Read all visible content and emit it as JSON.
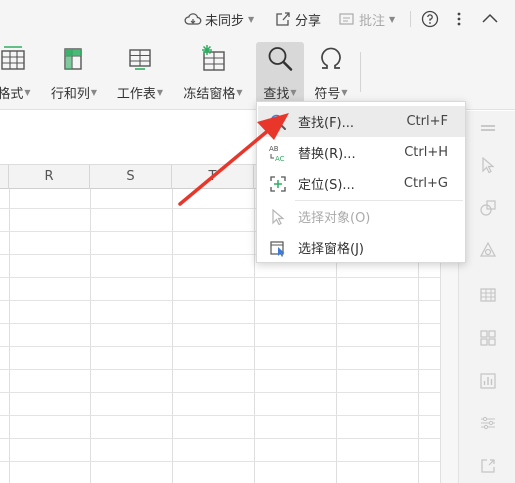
{
  "topbar": {
    "sync_label": "未同步",
    "share_label": "分享",
    "comment_label": "批注",
    "help_icon": "help-circle-icon",
    "more_icon": "more-vertical-icon",
    "collapse_icon": "chevron-up-icon"
  },
  "ribbon": {
    "format_label": "格式",
    "rowcol_label": "行和列",
    "sheet_label": "工作表",
    "freeze_label": "冻结窗格",
    "find_label": "查找",
    "symbol_label": "符号"
  },
  "columns": [
    "R",
    "S",
    "T"
  ],
  "menu": {
    "items": [
      {
        "label": "查找(F)...",
        "shortcut": "Ctrl+F",
        "icon": "search-icon"
      },
      {
        "label": "替换(R)...",
        "shortcut": "Ctrl+H",
        "icon": "replace-icon"
      },
      {
        "label": "定位(S)...",
        "shortcut": "Ctrl+G",
        "icon": "locate-icon"
      },
      {
        "label": "选择对象(O)",
        "shortcut": "",
        "icon": "select-object-icon"
      },
      {
        "label": "选择窗格(J)",
        "shortcut": "",
        "icon": "selection-pane-icon"
      }
    ]
  },
  "colors": {
    "annotation_arrow": "#e8362a",
    "accent_green": "#2fae63",
    "accent_blue": "#3d7bd9"
  }
}
